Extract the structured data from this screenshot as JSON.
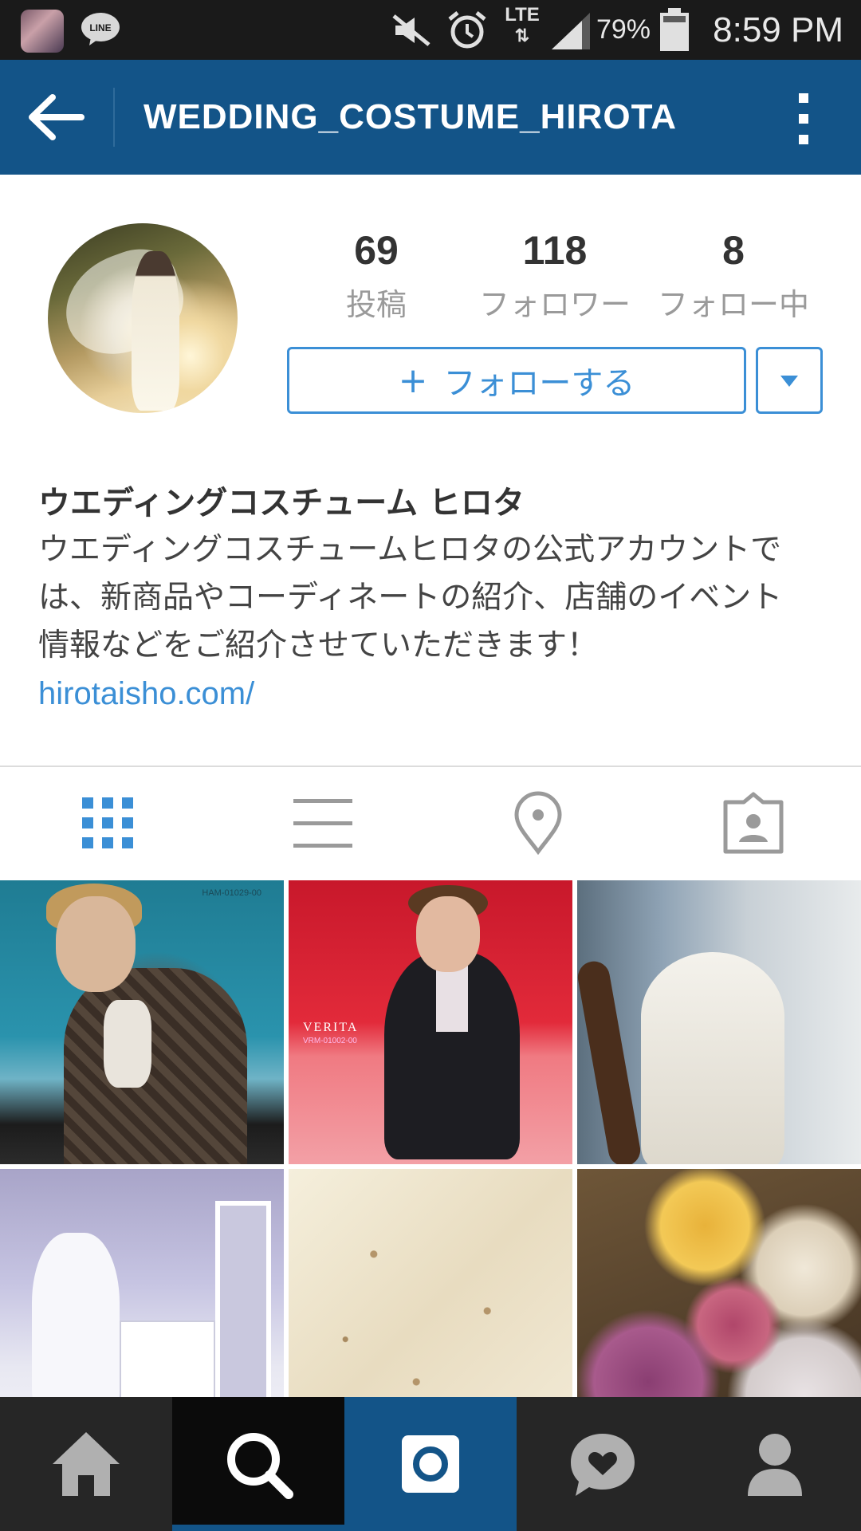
{
  "status_bar": {
    "time": "8:59 PM",
    "battery_percent": "79%",
    "network": "LTE",
    "notification_icons": [
      "app-thumbnail-icon",
      "line-icon"
    ],
    "system_icons": [
      "mute-icon",
      "alarm-icon",
      "lte-icon",
      "signal-icon",
      "battery-icon"
    ]
  },
  "app_bar": {
    "title": "WEDDING_COSTUME_HIROTA",
    "back_icon": "back-arrow-icon",
    "menu_icon": "more-vert-icon",
    "color": "#135488"
  },
  "profile": {
    "stats": [
      {
        "value": "69",
        "label": "投稿"
      },
      {
        "value": "118",
        "label": "フォロワー"
      },
      {
        "value": "8",
        "label": "フォロー中"
      }
    ],
    "follow_button": {
      "plus": "+",
      "label": "フォローする"
    },
    "dropdown_icon": "caret-down-icon",
    "name": "ウエディングコスチューム ヒロタ",
    "bio_lines": [
      "ウエディングコスチュームヒロタの公式アカウントで",
      "は、新商品やコーディネートの紹介、店舗のイベント",
      "情報などをご紹介させていただきます！"
    ],
    "link": "hirotaisho.com/"
  },
  "view_tabs": [
    {
      "icon": "grid-icon",
      "active": true
    },
    {
      "icon": "list-icon",
      "active": false
    },
    {
      "icon": "location-pin-icon",
      "active": false
    },
    {
      "icon": "tagged-photos-icon",
      "active": false
    }
  ],
  "photo_grid": {
    "tiles": [
      {
        "subject": "groom in checked tuxedo",
        "caption": "HAM-01029-00"
      },
      {
        "subject": "man in black suit on red background",
        "brand": "VERITA",
        "caption": "VRM-01002-00"
      },
      {
        "subject": "bride in gown on staircase"
      },
      {
        "subject": "wedding dresses in fitting room"
      },
      {
        "subject": "embroidered lace fabric detail"
      },
      {
        "subject": "flower bouquet"
      }
    ]
  },
  "bottom_nav": [
    {
      "icon": "home-icon",
      "active": false
    },
    {
      "icon": "search-icon",
      "active": true
    },
    {
      "icon": "camera-icon",
      "active": false
    },
    {
      "icon": "activity-heart-icon",
      "active": false
    },
    {
      "icon": "profile-icon",
      "active": false
    }
  ],
  "colors": {
    "accent": "#3b8fd6",
    "bar": "#135488",
    "nav_bg": "#262626"
  }
}
